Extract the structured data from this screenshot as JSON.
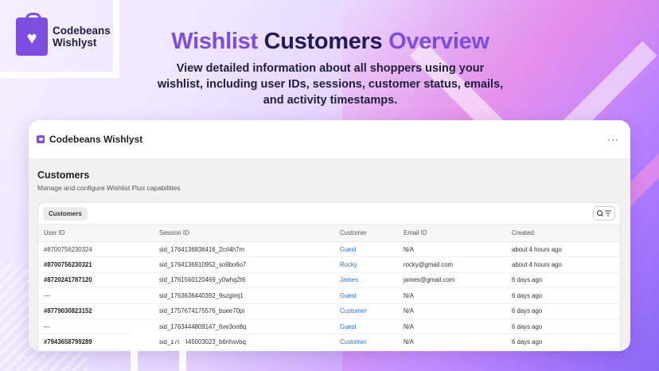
{
  "brand": {
    "name_line1": "Codebeans",
    "name_line2": "Wishlyst",
    "accent": "#7c4dde"
  },
  "hero": {
    "title_part1": "Wishlist",
    "title_part2": "Customers",
    "title_part3": "Overview",
    "subtitle": "View detailed information about all shoppers using your wishlist, including user IDs, sessions, customer status, emails, and activity timestamps."
  },
  "app": {
    "title": "Codebeans Wishlyst",
    "more_label": "···",
    "page_title": "Customers",
    "page_subtitle": "Manage and configure Wishlist Plus capabilities",
    "tab_label": "Customers",
    "icons": {
      "app": "bag-heart-icon",
      "more": "more-horizontal-icon",
      "filter": "search-filter-icon"
    }
  },
  "table": {
    "columns": [
      "User ID",
      "Session ID",
      "Customer",
      "Email ID",
      "Created"
    ],
    "rows": [
      {
        "user_id": "#8700756230324",
        "bold": false,
        "session": "sid_1764136836416_2crl4h7m",
        "customer": "Guest",
        "email": "N/A",
        "created": "about 4 hours ago"
      },
      {
        "user_id": "#8700756230321",
        "bold": true,
        "session": "sid_1764136910952_so9bo6o7",
        "customer": "Rocky",
        "email": "rocky@gmail.com",
        "created": "about 4 hours ago"
      },
      {
        "user_id": "#8720241787120",
        "bold": true,
        "session": "sid_1761560120469_y0whq2t6",
        "customer": "James",
        "email": "james@gmail.com",
        "created": "6 days ago"
      },
      {
        "user_id": "—",
        "bold": false,
        "session": "sid_1763636440392_9szgimj1",
        "customer": "Guest",
        "email": "N/A",
        "created": "6 days ago"
      },
      {
        "user_id": "#8779030823152",
        "bold": true,
        "session": "sid_1757674175576_buee70pi",
        "customer": "Customer",
        "email": "N/A",
        "created": "6 days ago"
      },
      {
        "user_id": "—",
        "bold": false,
        "session": "sid_1763444809147_6ve3on8q",
        "customer": "Guest",
        "email": "N/A",
        "created": "6 days ago"
      },
      {
        "user_id": "#7943658799289",
        "bold": true,
        "session": "sid_1763445003023_b6nhsvbq",
        "customer": "Customer",
        "email": "N/A",
        "created": "6 days ago"
      }
    ]
  }
}
